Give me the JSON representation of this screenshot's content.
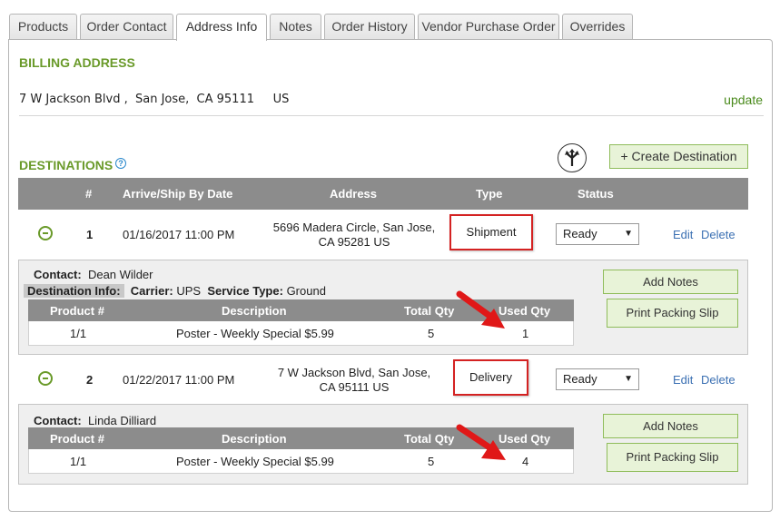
{
  "tabs": [
    "Products",
    "Order Contact",
    "Address Info",
    "Notes",
    "Order History",
    "Vendor Purchase Order",
    "Overrides"
  ],
  "active_tab": "Address Info",
  "billing": {
    "title": "BILLING ADDRESS",
    "street": "7 W Jackson Blvd ,",
    "city": "San Jose,",
    "state_zip": "CA 95111",
    "country": "US",
    "update_label": "update"
  },
  "destinations": {
    "title": "DESTINATIONS",
    "help": "?",
    "create_label": "+ Create Destination",
    "headers": {
      "num": "#",
      "date": "Arrive/Ship By Date",
      "address": "Address",
      "type": "Type",
      "status": "Status"
    },
    "rows": [
      {
        "num": "1",
        "date": "01/16/2017 11:00 PM",
        "address_line1": "5696 Madera Circle, San Jose,",
        "address_line2": "CA 95281 US",
        "type": "Shipment",
        "status": "Ready",
        "edit": "Edit",
        "delete": "Delete",
        "contact_label": "Contact:",
        "contact_name": "Dean Wilder",
        "dest_info_label": "Destination Info:",
        "carrier_label": "Carrier:",
        "carrier": "UPS",
        "service_label": "Service Type:",
        "service": "Ground",
        "add_notes": "Add Notes",
        "print_slip": "Print Packing Slip",
        "items": [
          {
            "product": "1/1",
            "description": "Poster - Weekly Special $5.99",
            "total_qty": "5",
            "used_qty": "1"
          }
        ]
      },
      {
        "num": "2",
        "date": "01/22/2017 11:00 PM",
        "address_line1": "7 W Jackson Blvd, San Jose,",
        "address_line2": "CA 95111 US",
        "type": "Delivery",
        "status": "Ready",
        "edit": "Edit",
        "delete": "Delete",
        "contact_label": "Contact:",
        "contact_name": "Linda Dilliard",
        "add_notes": "Add Notes",
        "print_slip": "Print Packing Slip",
        "items": [
          {
            "product": "1/1",
            "description": "Poster - Weekly Special $5.99",
            "total_qty": "5",
            "used_qty": "4"
          }
        ]
      }
    ],
    "item_headers": {
      "product": "Product #",
      "description": "Description",
      "total_qty": "Total Qty",
      "used_qty": "Used Qty"
    }
  },
  "icons": {
    "route": "route-split-icon",
    "collapse": "minus-circle-icon",
    "dropdown": "caret-down-icon",
    "annotation": "red-arrow-icon"
  },
  "colors": {
    "accent_green": "#6a9a2a",
    "header_gray": "#8c8c8c",
    "link_blue": "#3b70b3",
    "highlight_red": "#d42222"
  }
}
